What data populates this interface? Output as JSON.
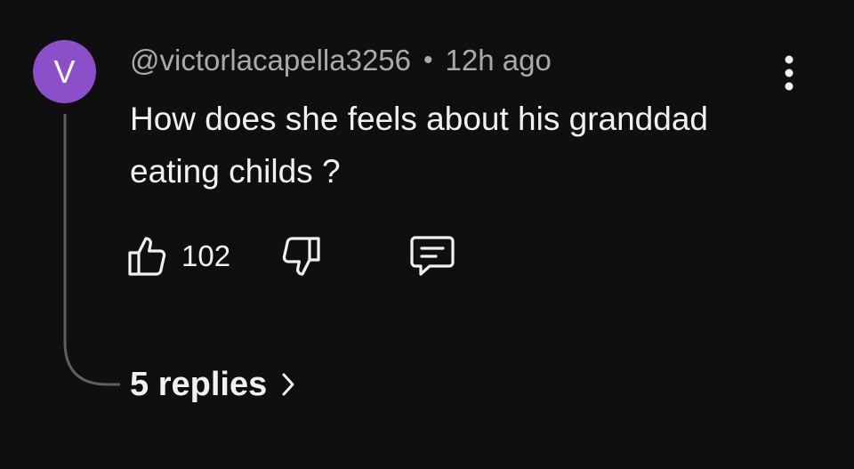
{
  "comment": {
    "avatar_letter": "V",
    "avatar_color": "#8a4fc9",
    "author": "@victorlacapella3256",
    "separator": "•",
    "time": "12h ago",
    "text": "How does she feels about his granddad eating childs ?",
    "like_count": "102"
  },
  "replies": {
    "label": "5 replies"
  },
  "icons": {
    "more": "more-vertical-icon",
    "like": "thumbs-up-icon",
    "dislike": "thumbs-down-icon",
    "reply": "comment-icon",
    "chevron": "chevron-right-icon"
  }
}
